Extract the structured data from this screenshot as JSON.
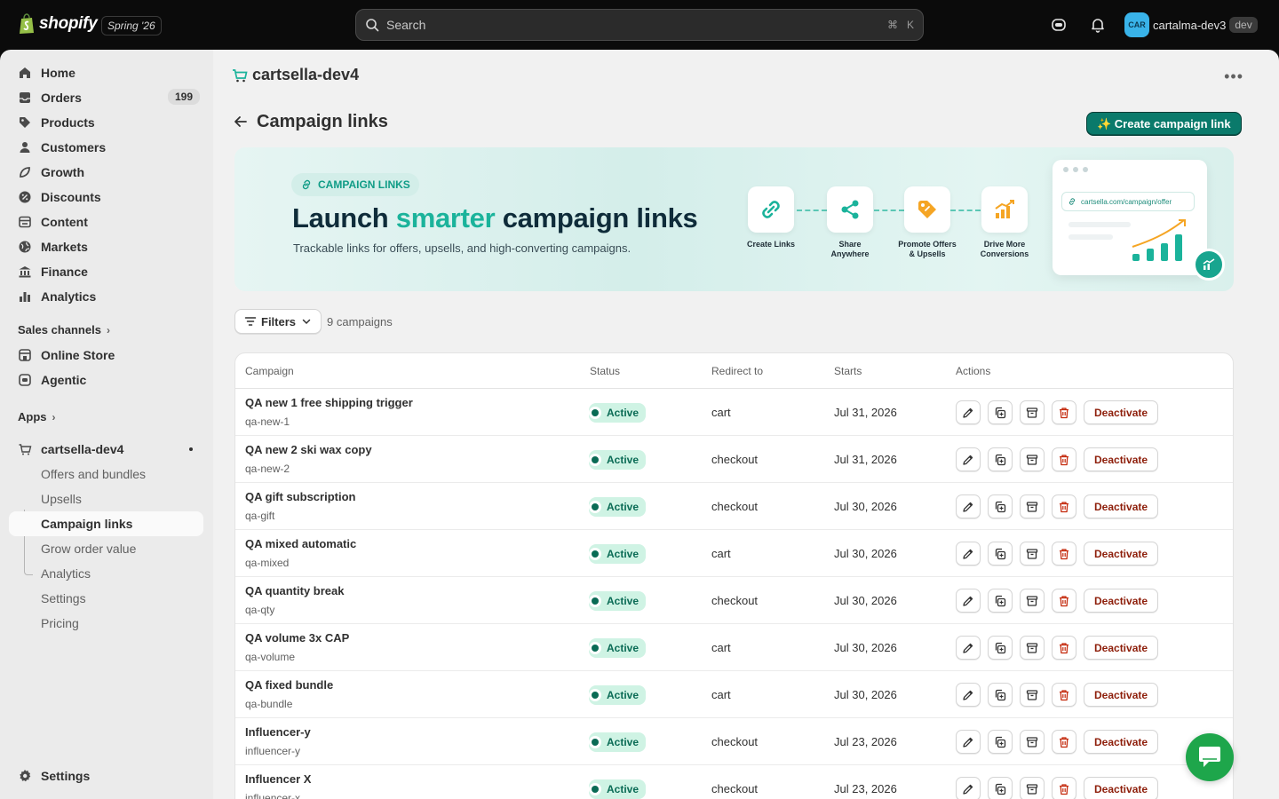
{
  "topbar": {
    "brand": "shopify",
    "edition": "Spring '26",
    "search_placeholder": "Search",
    "shortcut_cmd": "⌘",
    "shortcut_key": "K",
    "user_initials": "CAR",
    "user_name": "cartalma-dev3",
    "env_badge": "dev"
  },
  "sidebar": {
    "items": [
      {
        "label": "Home",
        "icon": "home-icon"
      },
      {
        "label": "Orders",
        "icon": "orders-icon",
        "count": "199"
      },
      {
        "label": "Products",
        "icon": "tag-icon"
      },
      {
        "label": "Customers",
        "icon": "person-icon"
      },
      {
        "label": "Growth",
        "icon": "growth-icon"
      },
      {
        "label": "Discounts",
        "icon": "discount-icon"
      },
      {
        "label": "Content",
        "icon": "content-icon"
      },
      {
        "label": "Markets",
        "icon": "globe-icon"
      },
      {
        "label": "Finance",
        "icon": "bank-icon"
      },
      {
        "label": "Analytics",
        "icon": "chart-bar-icon"
      }
    ],
    "sales_channels_heading": "Sales channels",
    "channels": [
      {
        "label": "Online Store",
        "icon": "store-icon"
      },
      {
        "label": "Agentic",
        "icon": "agent-icon"
      }
    ],
    "apps_heading": "Apps",
    "app_name": "cartsella-dev4",
    "app_subitems": [
      "Offers and bundles",
      "Upsells",
      "Campaign links",
      "Grow order value",
      "Analytics",
      "Settings",
      "Pricing"
    ],
    "active_subitem": "Campaign links",
    "settings_label": "Settings"
  },
  "page": {
    "app_title": "cartsella-dev4",
    "title": "Campaign links",
    "create_button": "✨ Create campaign link"
  },
  "banner": {
    "pill": "CAMPAIGN LINKS",
    "headline_a": "Launch ",
    "headline_accent": "smarter",
    "headline_b": " campaign links",
    "subtitle": "Trackable links for offers, upsells, and high-converting campaigns.",
    "features": [
      {
        "line1": "Create Links",
        "line2": ""
      },
      {
        "line1": "Share",
        "line2": "Anywhere"
      },
      {
        "line1": "Promote Offers",
        "line2": "& Upsells"
      },
      {
        "line1": "Drive More",
        "line2": "Conversions"
      }
    ],
    "mock_url": "cartsella.com/campaign/offer",
    "accent_color": "#1bb39b"
  },
  "filters": {
    "label": "Filters",
    "count_text": "9 campaigns"
  },
  "table": {
    "headers": [
      "Campaign",
      "Status",
      "Redirect to",
      "Starts",
      "Actions"
    ],
    "action_label": "Deactivate",
    "rows": [
      {
        "name": "QA new 1 free shipping trigger",
        "slug": "qa-new-1",
        "status": "Active",
        "redirect": "cart",
        "starts": "Jul 31, 2026"
      },
      {
        "name": "QA new 2 ski wax copy",
        "slug": "qa-new-2",
        "status": "Active",
        "redirect": "checkout",
        "starts": "Jul 31, 2026"
      },
      {
        "name": "QA gift subscription",
        "slug": "qa-gift",
        "status": "Active",
        "redirect": "checkout",
        "starts": "Jul 30, 2026"
      },
      {
        "name": "QA mixed automatic",
        "slug": "qa-mixed",
        "status": "Active",
        "redirect": "cart",
        "starts": "Jul 30, 2026"
      },
      {
        "name": "QA quantity break",
        "slug": "qa-qty",
        "status": "Active",
        "redirect": "checkout",
        "starts": "Jul 30, 2026"
      },
      {
        "name": "QA volume 3x CAP",
        "slug": "qa-volume",
        "status": "Active",
        "redirect": "cart",
        "starts": "Jul 30, 2026"
      },
      {
        "name": "QA fixed bundle",
        "slug": "qa-bundle",
        "status": "Active",
        "redirect": "cart",
        "starts": "Jul 30, 2026"
      },
      {
        "name": "Influencer-y",
        "slug": "influencer-y",
        "status": "Active",
        "redirect": "checkout",
        "starts": "Jul 23, 2026"
      },
      {
        "name": "Influencer X",
        "slug": "influencer-x",
        "status": "Active",
        "redirect": "checkout",
        "starts": "Jul 23, 2026"
      }
    ]
  }
}
